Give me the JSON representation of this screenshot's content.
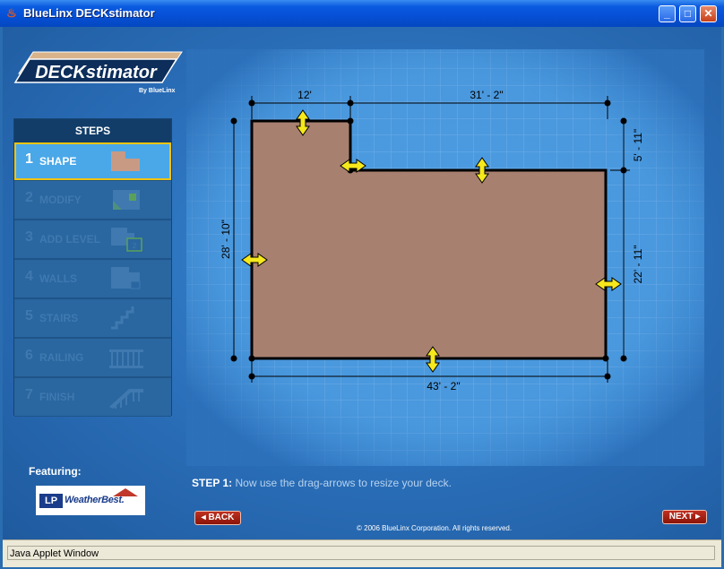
{
  "window": {
    "title": "BlueLinx DECKstimator",
    "minimize_label": "_",
    "maximize_label": "□",
    "close_label": "✕"
  },
  "logo": {
    "text": "DECKstimator",
    "byline": "By BlueLinx"
  },
  "steps": {
    "header": "STEPS",
    "items": [
      {
        "number": "1",
        "label": "SHAPE",
        "active": true
      },
      {
        "number": "2",
        "label": "MODIFY",
        "active": false
      },
      {
        "number": "3",
        "label": "ADD LEVEL",
        "active": false
      },
      {
        "number": "4",
        "label": "WALLS",
        "active": false
      },
      {
        "number": "5",
        "label": "STAIRS",
        "active": false
      },
      {
        "number": "6",
        "label": "RAILING",
        "active": false
      },
      {
        "number": "7",
        "label": "FINISH",
        "active": false
      }
    ]
  },
  "deck": {
    "dimensions": {
      "top_left_width": "12'",
      "top_right_width": "31' - 2\"",
      "left_height": "28' - 10\"",
      "right_top_height": "5' - 11\"",
      "right_bottom_height": "22' - 11\"",
      "bottom_width": "43' - 2\""
    },
    "fill_color": "#a88070",
    "outline_color": "#000000",
    "handle_color": "#f5e81c"
  },
  "featuring": {
    "label": "Featuring:",
    "sponsor_lp": "LP",
    "sponsor_name": "WeatherBest."
  },
  "instruction": {
    "step_no": "STEP 1:",
    "text": "Now use the drag-arrows to resize your deck."
  },
  "nav": {
    "back_label": "◂ BACK",
    "next_label": "NEXT ▸"
  },
  "copyright": "© 2006 BlueLinx Corporation.  All rights reserved.",
  "status_bar": {
    "text": "Java Applet Window"
  }
}
